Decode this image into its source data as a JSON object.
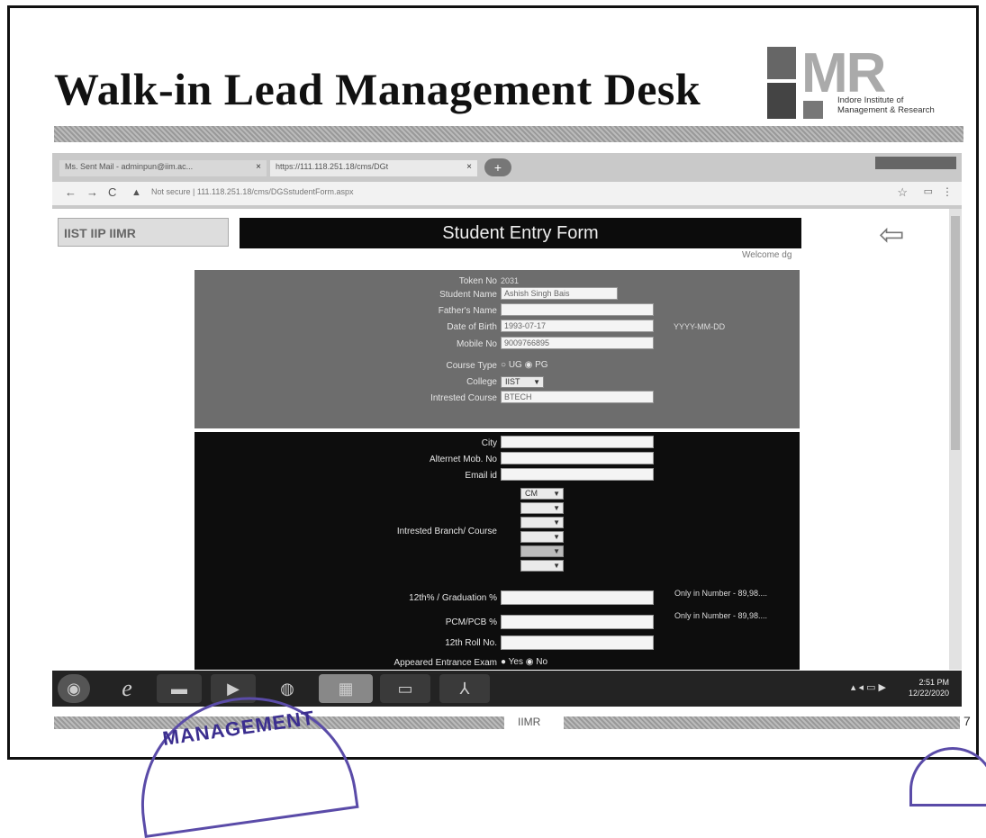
{
  "slide": {
    "title": "Walk-in Lead Management Desk",
    "logo": {
      "letters": "MR",
      "institute": "Indore Institute of Management & Research"
    },
    "footer_label": "IIMR",
    "page_number": "7",
    "stamp_text": "MANAGEMENT"
  },
  "browser": {
    "tabs": [
      {
        "label": "Ms. Sent Mail - adminpun@iim.ac..."
      },
      {
        "label": "https://111.118.251.18/cms/DGt"
      }
    ],
    "new_tab": "+",
    "url_prefix": "Not secure",
    "url": "111.118.251.18/cms/DGSstudentForm.aspx"
  },
  "app": {
    "logos": "IIST IIP IIMR",
    "header": "Student Entry Form",
    "welcome": "Welcome dg"
  },
  "form": {
    "token_label": "Token No",
    "token_value": "2031",
    "student_name_label": "Student Name",
    "student_name_value": "Ashish Singh Bais",
    "father_name_label": "Father's Name",
    "father_name_value": "",
    "dob_label": "Date of Birth",
    "dob_value": "1993-07-17",
    "dob_hint": "YYYY-MM-DD",
    "mobile_label": "Mobile No",
    "mobile_value": "9009766895",
    "course_type_label": "Course Type",
    "course_type_options": [
      "UG",
      "PG"
    ],
    "course_type_selected": "PG",
    "college_label": "College",
    "college_value": "IIST",
    "interested_course_label": "Intrested Course",
    "interested_course_value": "BTECH",
    "city_label": "City",
    "alt_mob_label": "Alternet Mob. No",
    "email_label": "Email id",
    "branch_label": "Intrested Branch/ Course",
    "branch_options": [
      "CM",
      "",
      "",
      "",
      "",
      ""
    ],
    "grad_label": "12th% / Graduation %",
    "grad_hint": "Only in Number - 89,98....",
    "pcm_label": "PCM/PCB %",
    "pcm_hint": "Only in Number - 89,98....",
    "roll_label": "12th Roll No.",
    "exam_label": "Appeared Entrance Exam",
    "exam_options": [
      "Yes",
      "No"
    ],
    "exam_selected": "No"
  },
  "taskbar": {
    "clock_time": "2:51 PM",
    "clock_date": "12/22/2020"
  }
}
